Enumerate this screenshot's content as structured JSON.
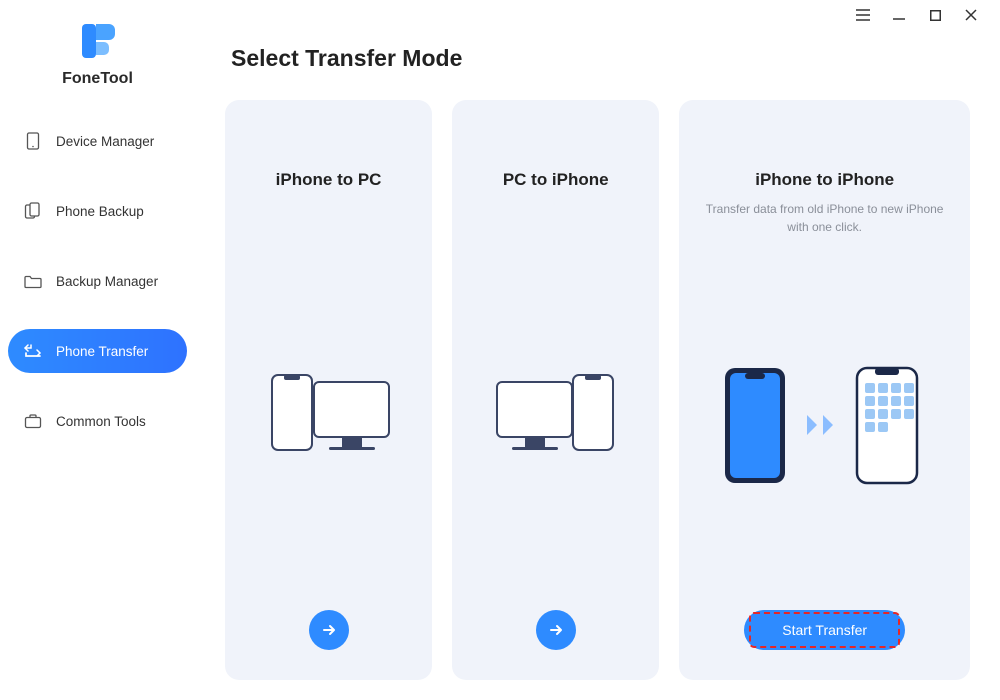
{
  "app": {
    "name": "FoneTool"
  },
  "sidebar": {
    "items": [
      {
        "label": "Device Manager",
        "icon": "device-tablet-icon",
        "active": false
      },
      {
        "label": "Phone Backup",
        "icon": "phone-copy-icon",
        "active": false
      },
      {
        "label": "Backup Manager",
        "icon": "folder-icon",
        "active": false
      },
      {
        "label": "Phone Transfer",
        "icon": "transfer-icon",
        "active": true
      },
      {
        "label": "Common Tools",
        "icon": "briefcase-icon",
        "active": false
      }
    ]
  },
  "page": {
    "title": "Select Transfer Mode"
  },
  "cards": [
    {
      "title": "iPhone to PC",
      "action_type": "arrow"
    },
    {
      "title": "PC to iPhone",
      "action_type": "arrow"
    },
    {
      "title": "iPhone to iPhone",
      "description": "Transfer data from old iPhone to new iPhone with one click.",
      "action_label": "Start Transfer",
      "action_type": "button",
      "highlighted": true
    }
  ],
  "colors": {
    "accent": "#2e8bff",
    "highlight": "#e62727",
    "card_bg": "#f0f3fa"
  }
}
